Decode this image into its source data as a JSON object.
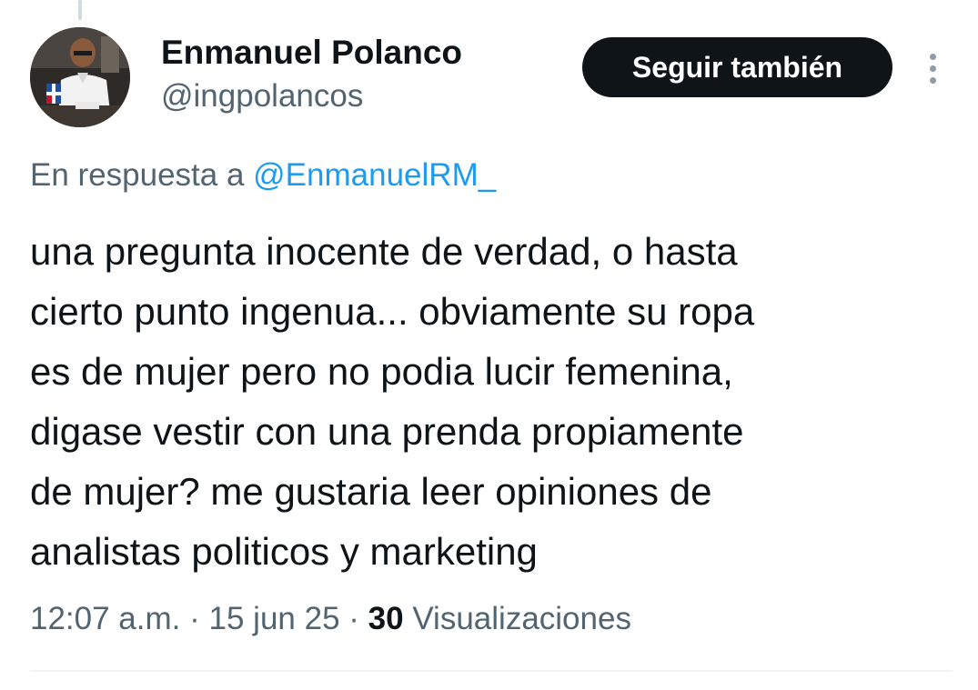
{
  "tweet": {
    "author": {
      "display_name": "Enmanuel Polanco",
      "handle": "@ingpolancos",
      "avatar_icon": "profile-photo"
    },
    "follow_button_label": "Seguir también",
    "more_icon": "more-vertical-icon",
    "reply_context": {
      "prefix": "En respuesta a ",
      "mention": "@EnmanuelRM_"
    },
    "text_lines": [
      "una pregunta inocente de verdad, o hasta",
      "cierto punto ingenua... obviamente su ropa",
      "es de mujer pero no podia lucir femenina,",
      "digase vestir con una prenda propiamente",
      "de mujer? me gustaria leer opiniones de",
      "analistas politicos y marketing"
    ],
    "meta": {
      "time": "12:07 a.m.",
      "separator": "·",
      "date": "15 jun 25",
      "views_count": "30",
      "views_label": "Visualizaciones"
    }
  },
  "colors": {
    "text_primary": "#0f1419",
    "text_secondary": "#536471",
    "link": "#1d9bf0",
    "button_bg": "#0f1419",
    "divider": "#eff3f4"
  }
}
